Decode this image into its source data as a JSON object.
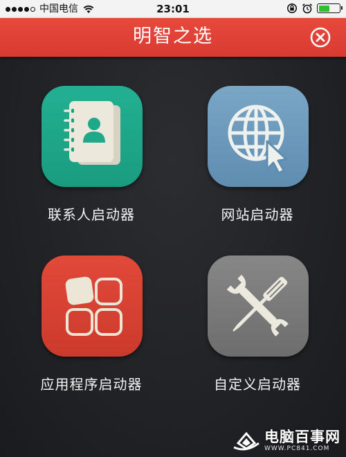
{
  "status_bar": {
    "carrier": "中国电信",
    "time": "23:01",
    "signal_bars_filled": 4,
    "signal_bars_total": 5,
    "battery_level": 0.55,
    "icons": [
      "signal-dots-icon",
      "wifi-icon",
      "rotation-lock-icon",
      "alarm-icon",
      "battery-icon"
    ]
  },
  "header": {
    "title": "明智之选",
    "close_icon": "close-icon"
  },
  "tiles": [
    {
      "label": "联系人启动器",
      "icon": "contacts-book-icon",
      "color": "#1fa889"
    },
    {
      "label": "网站启动器",
      "icon": "globe-cursor-icon",
      "color": "#6d9bbd"
    },
    {
      "label": "应用程序启动器",
      "icon": "app-grid-icon",
      "color": "#d8402f"
    },
    {
      "label": "自定义启动器",
      "icon": "tools-icon",
      "color": "#7b7b7b"
    }
  ],
  "watermark": {
    "text": "电脑百事网",
    "url": "WWW.PC841.COM",
    "logo_icon": "watermark-logo-icon"
  },
  "colors": {
    "header": "#e0443a",
    "background": "#232428",
    "status_bar": "#f3f3f3"
  }
}
